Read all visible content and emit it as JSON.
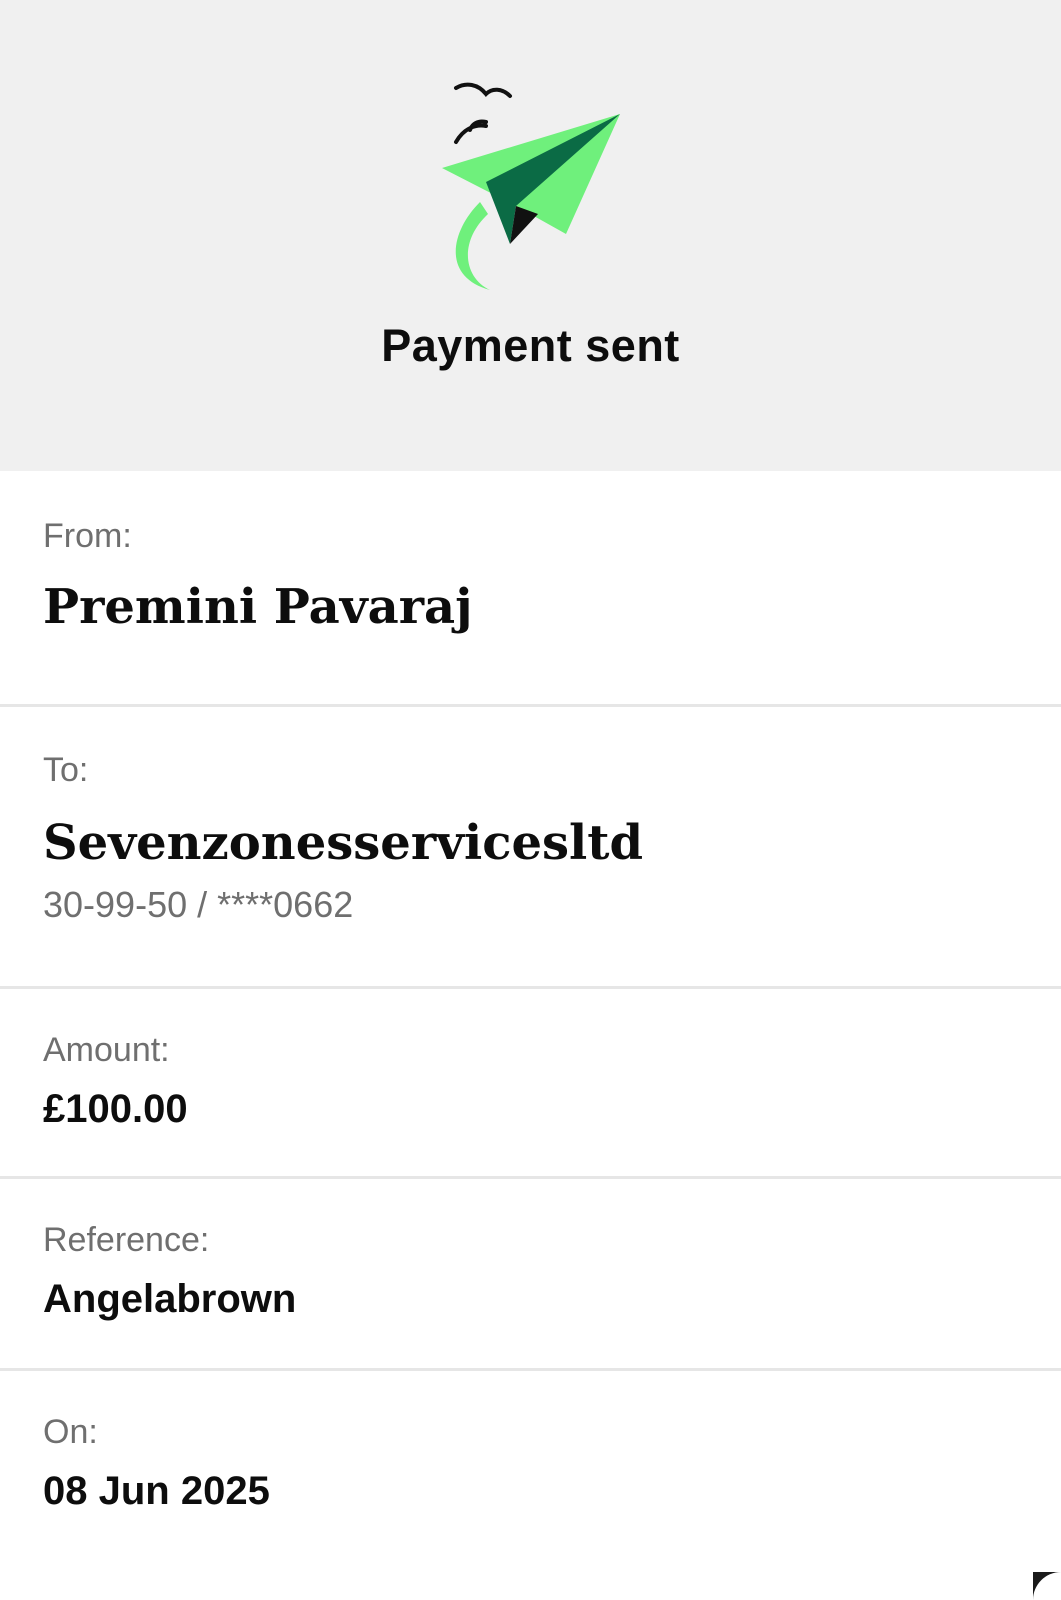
{
  "header": {
    "title": "Payment sent",
    "illustration": "paper-plane-icon",
    "colors": {
      "plane_light": "#6ff07c",
      "plane_dark": "#0b6b45",
      "background": "#f0f0f0"
    }
  },
  "details": {
    "from": {
      "label": "From:",
      "value": "Premini Pavaraj"
    },
    "to": {
      "label": "To:",
      "value": "Sevenzonesservicesltd",
      "account": "30-99-50 / ****0662"
    },
    "amount": {
      "label": "Amount:",
      "value": "£100.00"
    },
    "reference": {
      "label": "Reference:",
      "value": "Angelabrown"
    },
    "on": {
      "label": "On:",
      "value": "08 Jun 2025"
    }
  }
}
